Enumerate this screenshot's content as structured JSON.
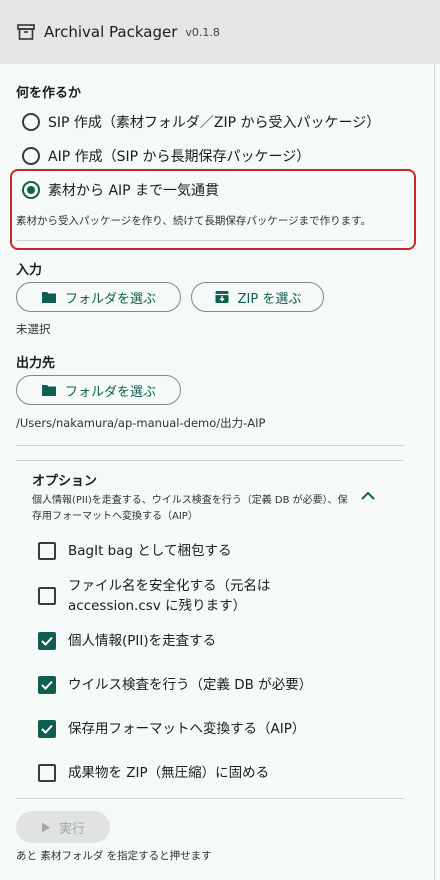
{
  "header": {
    "title": "Archival Packager",
    "version": "v0.1.8",
    "icon": "archive-box-icon"
  },
  "mode": {
    "label": "何を作るか",
    "options": [
      {
        "label": "SIP 作成（素材フォルダ／ZIP から受入パッケージ）",
        "selected": false
      },
      {
        "label": "AIP 作成（SIP から長期保存パッケージ）",
        "selected": false
      },
      {
        "label": "素材から AIP まで一気通貫",
        "selected": true
      }
    ],
    "description": "素材から受入パッケージを作り、続けて長期保存パッケージまで作ります。"
  },
  "input": {
    "label": "入力",
    "folder_button": "フォルダを選ぶ",
    "zip_button": "ZIP を選ぶ",
    "status": "未選択"
  },
  "output": {
    "label": "出力先",
    "folder_button": "フォルダを選ぶ",
    "path": "/Users/nakamura/ap-manual-demo/出力-AIP"
  },
  "options": {
    "title": "オプション",
    "summary": "個人情報(PII)を走査する、ウイルス検査を行う（定義 DB が必要）、保存用フォーマットへ変換する（AIP）",
    "expanded": true,
    "items": [
      {
        "label": "BagIt bag として梱包する",
        "checked": false
      },
      {
        "label": "ファイル名を安全化する（元名は accession.csv に残ります）",
        "checked": false
      },
      {
        "label": "個人情報(PII)を走査する",
        "checked": true
      },
      {
        "label": "ウイルス検査を行う（定義 DB が必要）",
        "checked": true
      },
      {
        "label": "保存用フォーマットへ変換する（AIP）",
        "checked": true
      },
      {
        "label": "成果物を ZIP（無圧縮）に固める",
        "checked": false
      }
    ]
  },
  "run": {
    "label": "実行",
    "enabled": false,
    "hint": "あと 素材フォルダ を指定すると押せます"
  },
  "colors": {
    "accent": "#0f5e50",
    "highlight": "#c62828",
    "header_bg": "#e3e6e4",
    "page_bg": "#f5f9f7"
  }
}
